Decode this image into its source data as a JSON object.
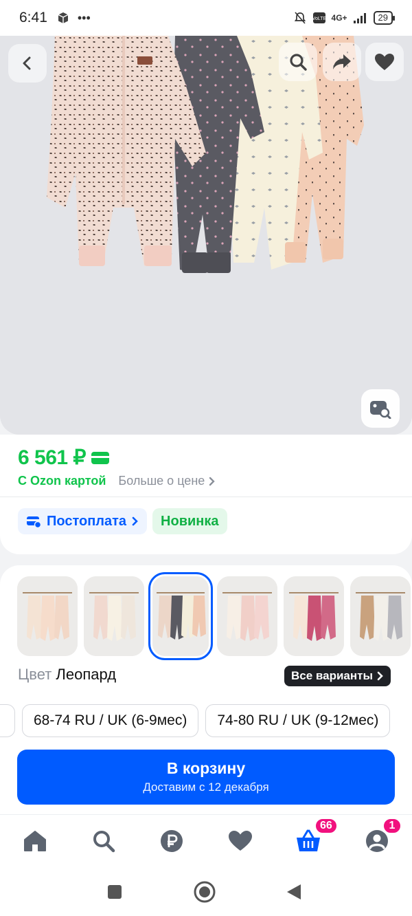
{
  "status_bar": {
    "time": "6:41",
    "dots": "•••",
    "network": "4G+",
    "battery": "29"
  },
  "hero": {
    "icons": [
      "back-icon",
      "search-icon",
      "share-icon",
      "heart-icon",
      "image-search-icon"
    ]
  },
  "price": {
    "value": "6 561 ₽",
    "ozon_card": "С Ozon картой",
    "more": "Больше о цене",
    "color": "#10c44c"
  },
  "badges": {
    "postpay": "Постоплата",
    "new": "Новинка"
  },
  "variants": {
    "swatch_count": 6,
    "selected_index": 2,
    "color_label": "Цвет",
    "color_value": "Леопард",
    "all_variants": "Все варианты",
    "sizes": [
      "68-74 RU / UK (6-9мес)",
      "74-80 RU / UK (9-12мес)"
    ]
  },
  "cart_button": {
    "title": "В корзину",
    "subtitle": "Доставим с 12 декабря",
    "color": "#005bff"
  },
  "bottom_nav": {
    "items": [
      "home-icon",
      "search-icon",
      "ruble-icon",
      "heart-icon",
      "cart-icon",
      "profile-icon"
    ],
    "cart_badge": "66",
    "profile_badge": "1"
  }
}
